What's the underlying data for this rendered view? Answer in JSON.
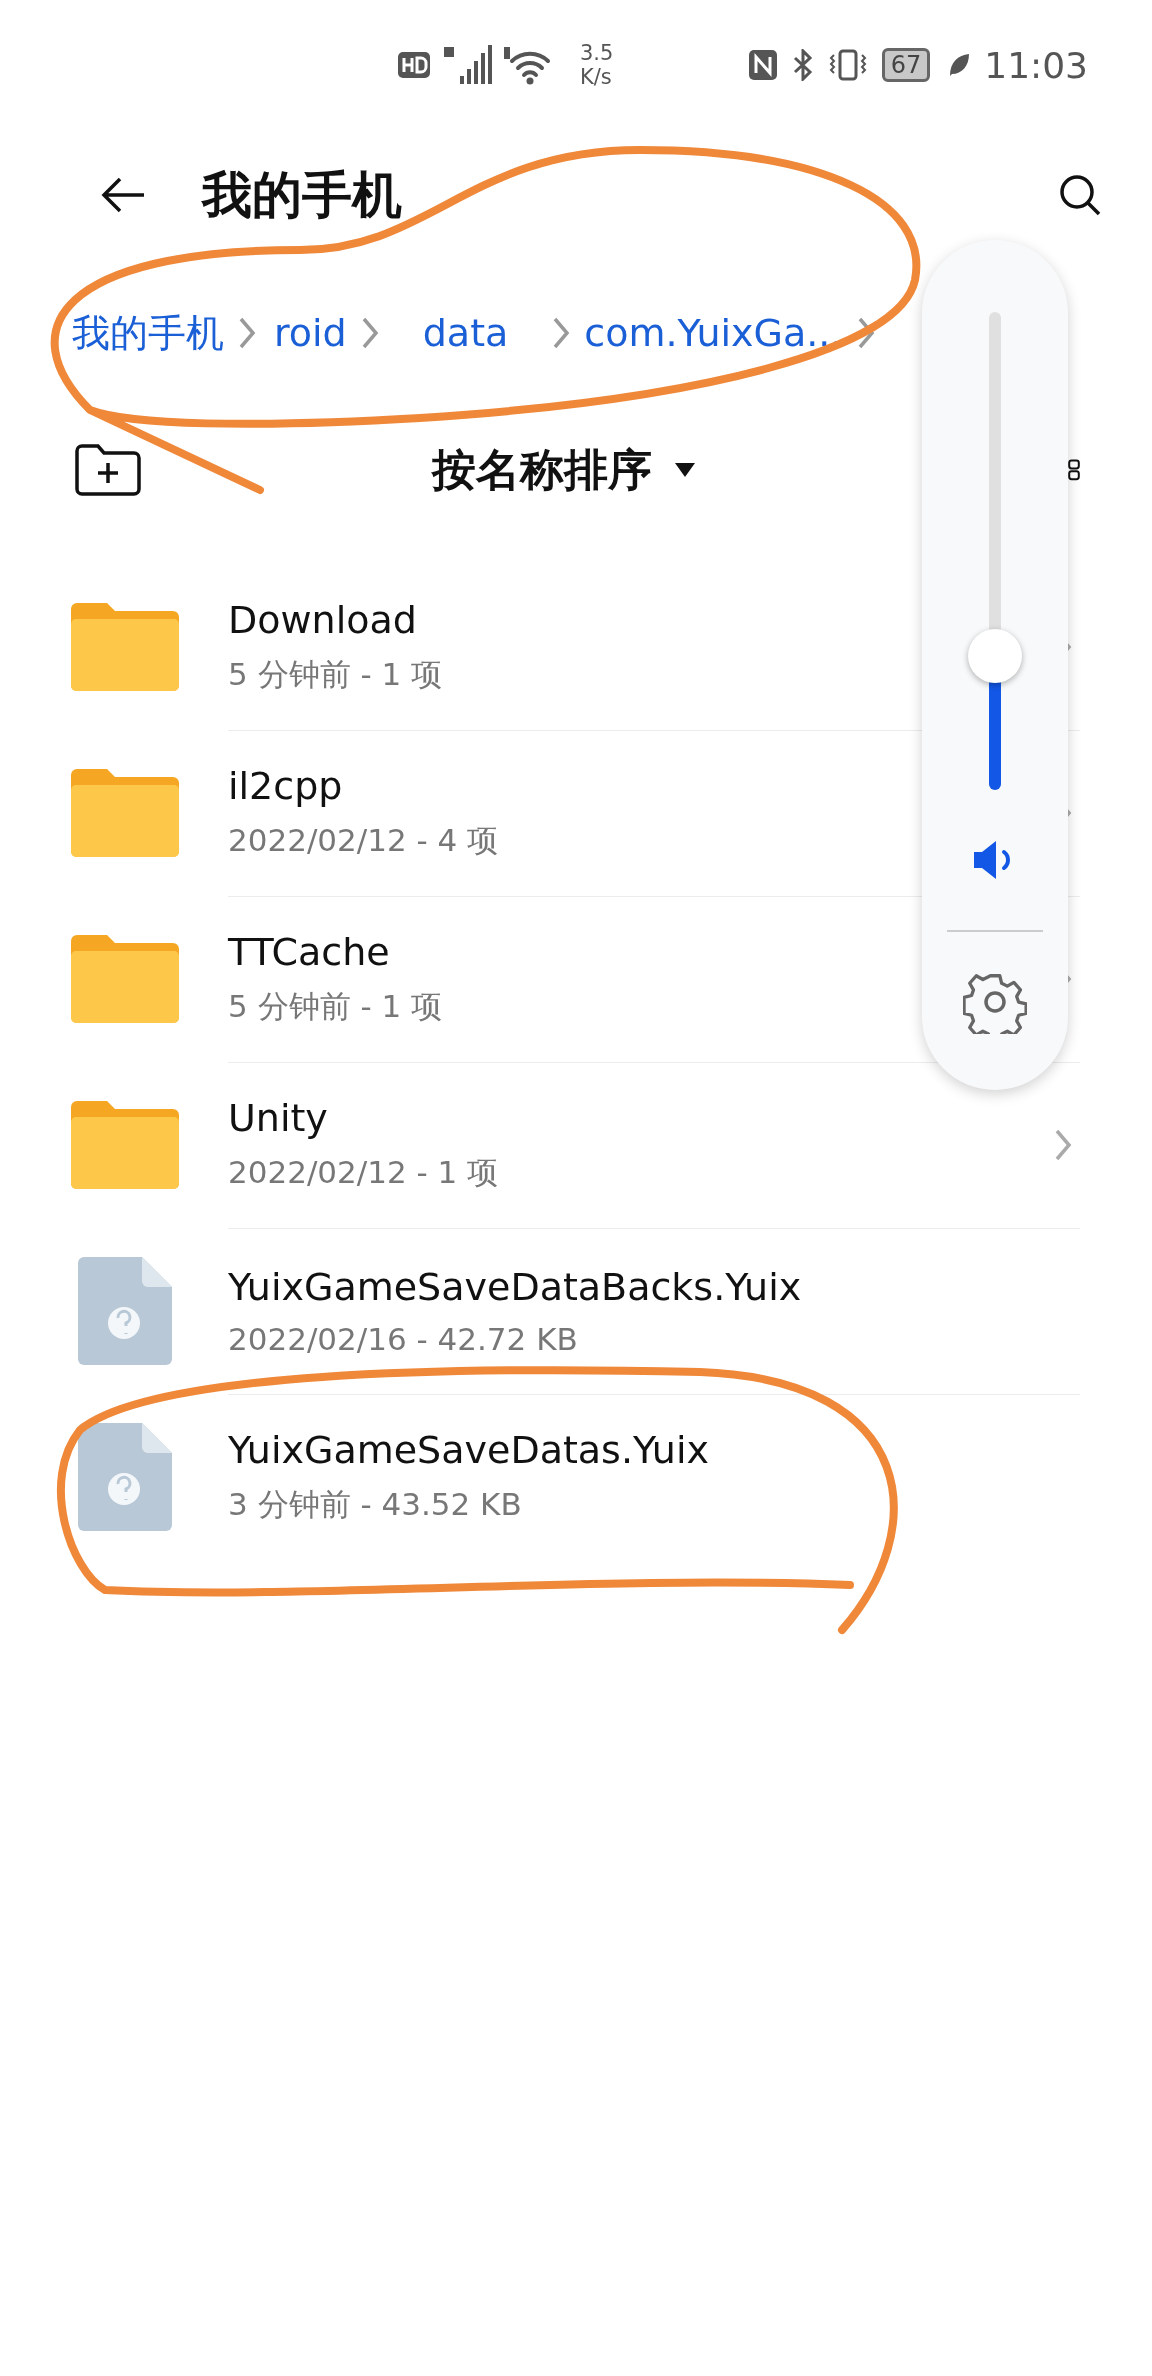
{
  "status_bar": {
    "network_speed": "3.5",
    "speed_unit": "K/s",
    "battery": "67",
    "time": "11:03"
  },
  "header": {
    "title": "我的手机"
  },
  "breadcrumb": [
    {
      "label": "我的手机"
    },
    {
      "label": "roid"
    },
    {
      "label": "data"
    },
    {
      "label": "com.YuixGa..."
    }
  ],
  "sort": {
    "label": "按名称排序"
  },
  "volume": {
    "level": 0.28
  },
  "files": [
    {
      "kind": "folder",
      "name": "Download",
      "meta": "5 分钟前 - 1 项"
    },
    {
      "kind": "folder",
      "name": "il2cpp",
      "meta": "2022/02/12 - 4 项"
    },
    {
      "kind": "folder",
      "name": "TTCache",
      "meta": "5 分钟前 - 1 项"
    },
    {
      "kind": "folder",
      "name": "Unity",
      "meta": "2022/02/12 - 1 项"
    },
    {
      "kind": "unknown",
      "name": "YuixGameSaveDataBacks.Yuix",
      "meta": "2022/02/16 - 42.72 KB"
    },
    {
      "kind": "unknown",
      "name": "YuixGameSaveDatas.Yuix",
      "meta": "3 分钟前 - 43.52 KB"
    }
  ]
}
